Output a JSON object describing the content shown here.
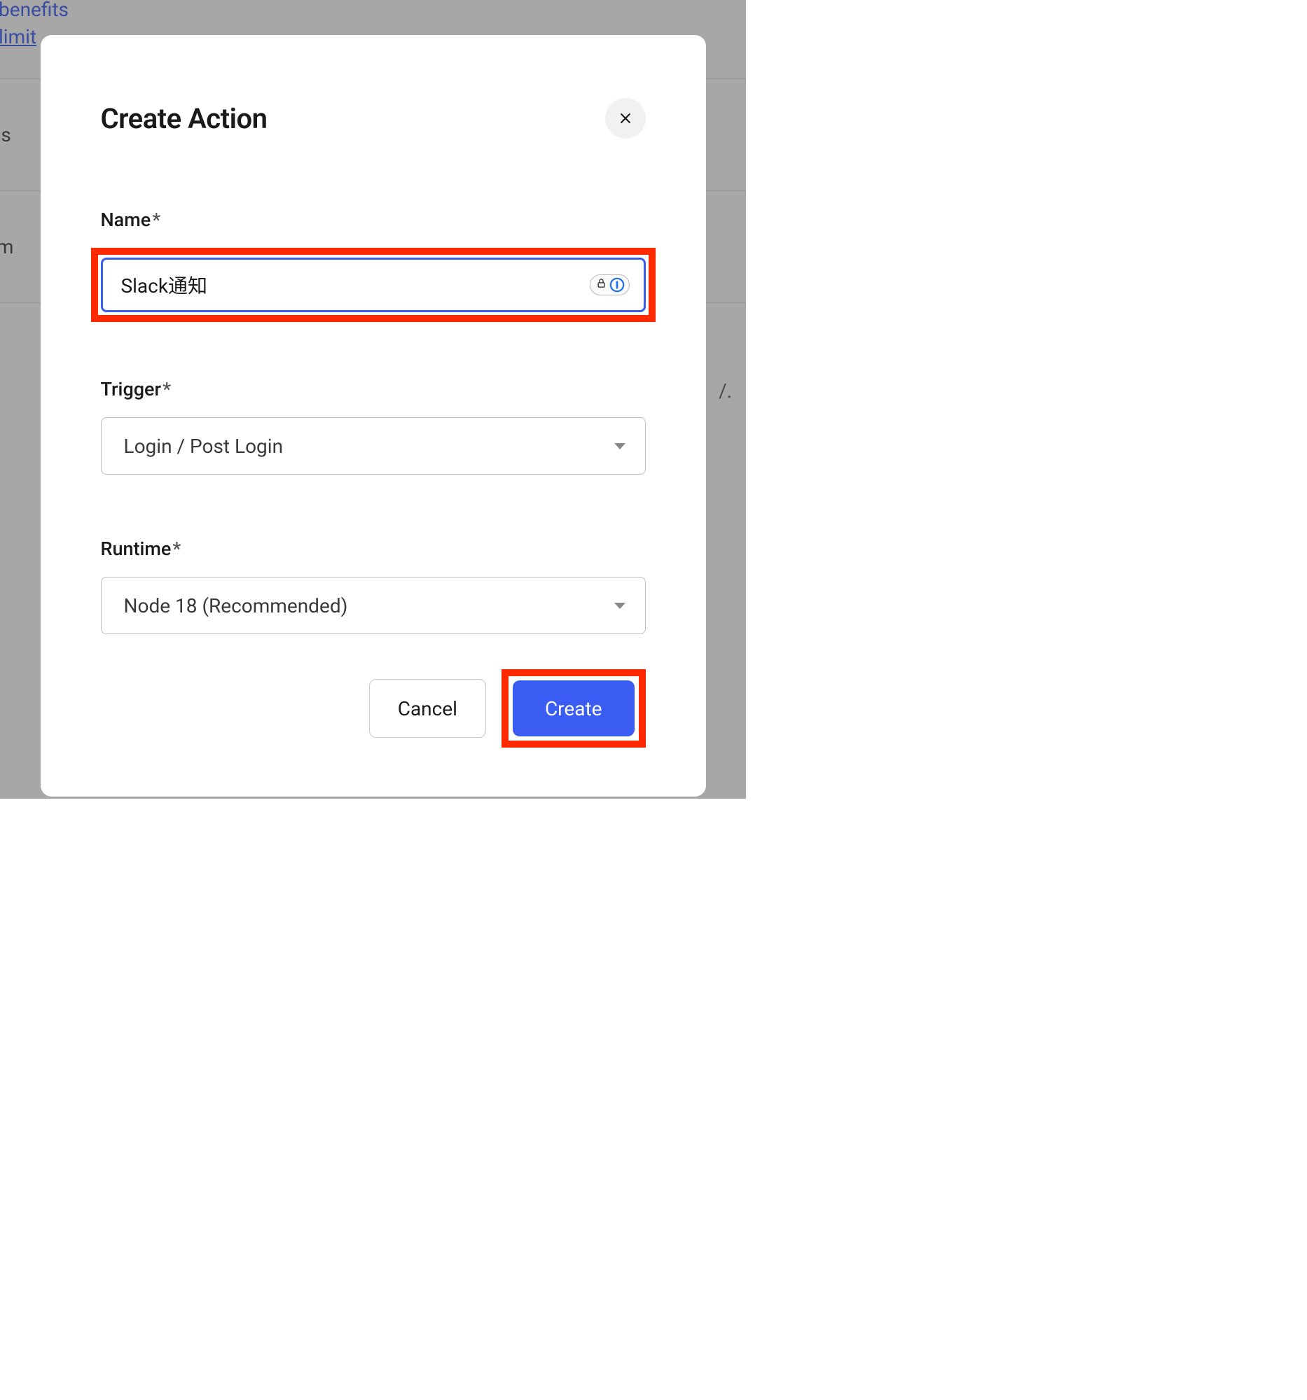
{
  "background": {
    "topText1": "benefits",
    "topText2": "limit",
    "row1": "ons",
    "row2": "tom",
    "bottomChar": "/."
  },
  "modal": {
    "title": "Create Action",
    "name": {
      "label": "Name",
      "required": "*",
      "value": "Slack通知"
    },
    "trigger": {
      "label": "Trigger",
      "required": "*",
      "value": "Login / Post Login"
    },
    "runtime": {
      "label": "Runtime",
      "required": "*",
      "value": "Node 18 (Recommended)"
    },
    "buttons": {
      "cancel": "Cancel",
      "create": "Create"
    }
  }
}
